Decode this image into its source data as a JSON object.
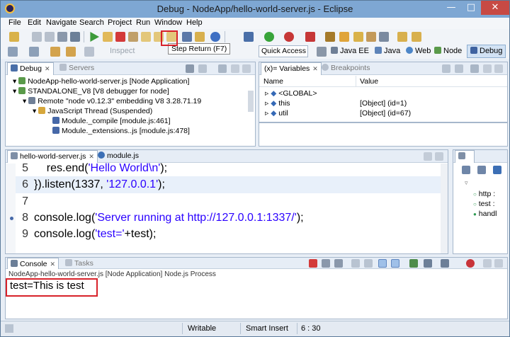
{
  "window": {
    "title": "Debug - NodeApp/hello-world-server.js - Eclipse",
    "min": "—",
    "max": "□",
    "close": "✕"
  },
  "menu": [
    "File",
    "Edit",
    "Navigate",
    "Search",
    "Project",
    "Run",
    "Window",
    "Help"
  ],
  "tooltip": "Step Return (F7)",
  "toolbar2": {
    "inspect": "Inspect",
    "quick_access": "Quick Access",
    "perspectives": [
      "Java EE",
      "Java",
      "Web",
      "Node",
      "Debug"
    ]
  },
  "debug_view": {
    "tabs": [
      "Debug",
      "Servers"
    ],
    "rows": [
      "NodeApp-hello-world-server.js [Node Application]",
      "STANDALONE_V8 [V8 debugger for node]",
      "Remote \"node v0.12.3\" embedding V8 3.28.71.19",
      "JavaScript Thread (Suspended)",
      "Module._compile [module.js:461]",
      "Module._extensions..js [module.js:478]"
    ]
  },
  "variables_view": {
    "tabs": [
      "Variables",
      "Breakpoints"
    ],
    "tab_prefix": "(x)=",
    "columns": [
      "Name",
      "Value"
    ],
    "rows": [
      {
        "name": "<GLOBAL>",
        "value": ""
      },
      {
        "name": "this",
        "value": "[Object]  (id=1)"
      },
      {
        "name": "util",
        "value": "[Object]  (id=67)"
      }
    ]
  },
  "editor": {
    "tabs": [
      "hello-world-server.js",
      "module.js"
    ],
    "lines": [
      {
        "num": "5",
        "pre": "    res.end(",
        "str": "'Hello World\\n'",
        "post": ");"
      },
      {
        "num": "6",
        "pre": "}).listen(1337, ",
        "str": "'127.0.0.1'",
        "post": ");"
      },
      {
        "num": "7",
        "pre": "",
        "str": "",
        "post": ""
      },
      {
        "num": "8",
        "pre": "console.log(",
        "str": "'Server running at http://127.0.0.1:1337/'",
        "post": ");"
      },
      {
        "num": "9",
        "pre": "console.log(",
        "str": "'test='",
        "post": "+test);"
      }
    ]
  },
  "outline": {
    "items": [
      "http :",
      "test :",
      "handl"
    ]
  },
  "console": {
    "tabs": [
      "Console",
      "Tasks"
    ],
    "process": "NodeApp-hello-world-server.js [Node Application] Node.js Process",
    "output": "test=This is test"
  },
  "status": {
    "mode": "Writable",
    "insert": "Smart Insert",
    "position": "6 : 30"
  }
}
